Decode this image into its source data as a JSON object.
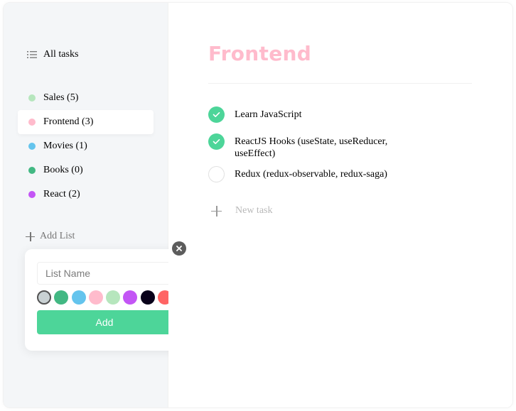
{
  "sidebar": {
    "all_tasks": {
      "label": "All tasks",
      "icon": "list-icon"
    },
    "lists": [
      {
        "label": "Sales (5)",
        "color": "#b6e6bd",
        "active": false
      },
      {
        "label": "Frontend (3)",
        "color": "#ffbbcc",
        "active": true
      },
      {
        "label": "Movies (1)",
        "color": "#64c4ed",
        "active": false
      },
      {
        "label": "Books (0)",
        "color": "#42b883",
        "active": false
      },
      {
        "label": "React (2)",
        "color": "#c355f5",
        "active": false
      }
    ],
    "add_list": {
      "label": "Add List",
      "icon": "plus-icon"
    }
  },
  "popup": {
    "close_icon": "close-icon",
    "input": {
      "placeholder": "List Name",
      "value": ""
    },
    "colors": [
      "#c9d1d3",
      "#42b883",
      "#64c4ed",
      "#ffbbcc",
      "#b6e6bd",
      "#c355f5",
      "#09011a",
      "#ff6464"
    ],
    "selected_color": "#c9d1d3",
    "button_label": "Add",
    "button_color": "#4dd599"
  },
  "main": {
    "title": "Frontend",
    "title_color": "#ffbbcc",
    "tasks": [
      {
        "text": "Learn JavaScript",
        "done": true
      },
      {
        "text": "ReactJS Hooks (useState, useReducer, useEffect)",
        "done": true
      },
      {
        "text": "Redux (redux-observable, redux-saga)",
        "done": false
      }
    ],
    "new_task": {
      "label": "New task",
      "icon": "plus-icon"
    }
  }
}
